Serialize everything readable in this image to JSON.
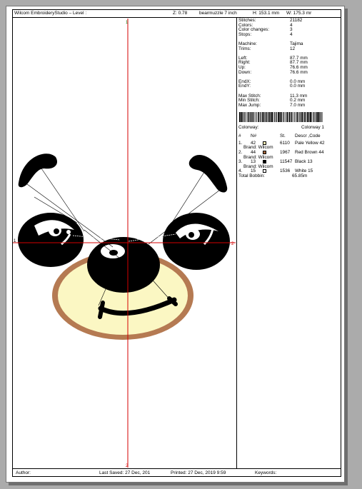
{
  "header": {
    "title": "Wilcom EmbroideryStudio – Level :",
    "zoom": "Z: 0.78",
    "design_name": "bearmuzzle 7 inch",
    "height": "H: 153.1 mm",
    "width": "W: 175.3 mr"
  },
  "stats": [
    {
      "label": "Stitches:",
      "value": "21182"
    },
    {
      "label": "Colors:",
      "value": "4"
    },
    {
      "label": "Color changes:",
      "value": "3"
    },
    {
      "label": "Stops:",
      "value": "4"
    },
    {
      "label": "",
      "value": ""
    },
    {
      "label": "Machine:",
      "value": "Tajima"
    },
    {
      "label": "Trims:",
      "value": "12"
    },
    {
      "label": "",
      "value": ""
    },
    {
      "label": "Left:",
      "value": "87.7 mm"
    },
    {
      "label": "Right:",
      "value": "87.7 mm"
    },
    {
      "label": "Up:",
      "value": "76.6 mm"
    },
    {
      "label": "Down:",
      "value": "76.6 mm"
    },
    {
      "label": "",
      "value": ""
    },
    {
      "label": "EndX:",
      "value": "0.0 mm"
    },
    {
      "label": "EndY:",
      "value": "0.0 mm"
    },
    {
      "label": "",
      "value": ""
    },
    {
      "label": "Max Stitch:",
      "value": "11.3 mm"
    },
    {
      "label": "Min Stitch:",
      "value": "0.2 mm"
    },
    {
      "label": "Max Jump:",
      "value": "7.0 mm"
    }
  ],
  "colorway": {
    "label": "Colorway:",
    "value": "Colorway 1"
  },
  "table_headers": {
    "num": "#",
    "n": "N#",
    "st": "St.",
    "desc": "Descr ,Code"
  },
  "threads": [
    {
      "idx": "1.",
      "n": "42",
      "color": "#fdf6b8",
      "stitches": "6110",
      "desc": "Pale Yellow 42",
      "brand": "Brand: Wilcom"
    },
    {
      "idx": "2.",
      "n": "44",
      "color": "#a5683f",
      "stitches": "1967",
      "desc": "Red Brown 44",
      "brand": "Brand: Wilcom"
    },
    {
      "idx": "3.",
      "n": "13",
      "color": "#000000",
      "stitches": "11547",
      "desc": "Black 13",
      "brand": "Brand: Wilcom"
    },
    {
      "idx": "4.",
      "n": "15",
      "color": "#ffffff",
      "stitches": "1536",
      "desc": "White 15",
      "brand": ""
    }
  ],
  "total_bobbin": {
    "label": "Total Bobbin:",
    "value": "65.85m"
  },
  "axis_marks": {
    "top": "1",
    "bottom": "2",
    "left": "1",
    "right": "2"
  },
  "footer": {
    "author": "Author:",
    "last_saved": "Last Saved: 27 Dec, 201",
    "printed": "Printed: 27 Dec, 2019  9:59",
    "keywords": "Keywords:"
  },
  "colors": {
    "crosshair": "#d40000",
    "muzzle_fill": "#fbf7c3",
    "muzzle_border": "#b57a52"
  }
}
